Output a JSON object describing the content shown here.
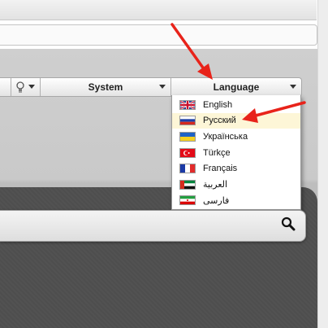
{
  "toolbar": {
    "system_label": "System",
    "language_label": "Language"
  },
  "language_menu": {
    "items": [
      {
        "label": "English",
        "flag": "uk-flag-icon"
      },
      {
        "label": "Русский",
        "flag": "russia-flag-icon",
        "highlighted": true
      },
      {
        "label": "Українська",
        "flag": "ukraine-flag-icon"
      },
      {
        "label": "Türkçe",
        "flag": "turkey-flag-icon"
      },
      {
        "label": "Français",
        "flag": "france-flag-icon"
      },
      {
        "label": "العربية",
        "flag": "uae-flag-icon"
      },
      {
        "label": "فارسی",
        "flag": "iran-flag-icon"
      }
    ]
  },
  "colors": {
    "annotation_arrow": "#e8231a",
    "highlight_row": "#fdf6d7"
  },
  "icons": {
    "bulb": "lightbulb-icon",
    "search": "search-icon"
  }
}
